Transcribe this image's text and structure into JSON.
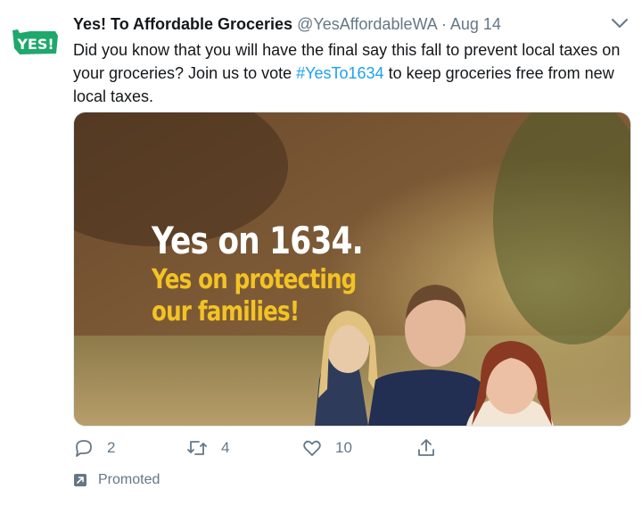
{
  "tweet": {
    "author_name": "Yes! To Affordable Groceries",
    "author_handle": "@YesAffordableWA",
    "separator": "·",
    "date": "Aug 14",
    "avatar_text": "YES!",
    "text_before": "Did you know that you will have the final say this fall to prevent local taxes on your groceries? Join us to vote ",
    "hashtag": "#YesTo1634",
    "text_after": " to keep groceries free from new local taxes."
  },
  "media": {
    "headline": "Yes on 1634.",
    "subline1": "Yes on protecting",
    "subline2": "our families!"
  },
  "actions": {
    "reply_count": "2",
    "retweet_count": "4",
    "like_count": "10"
  },
  "promoted_label": "Promoted",
  "colors": {
    "brand_green": "#1fa86b",
    "link": "#1da1f2",
    "muted": "#657786",
    "headline_yellow": "#f2c325"
  }
}
